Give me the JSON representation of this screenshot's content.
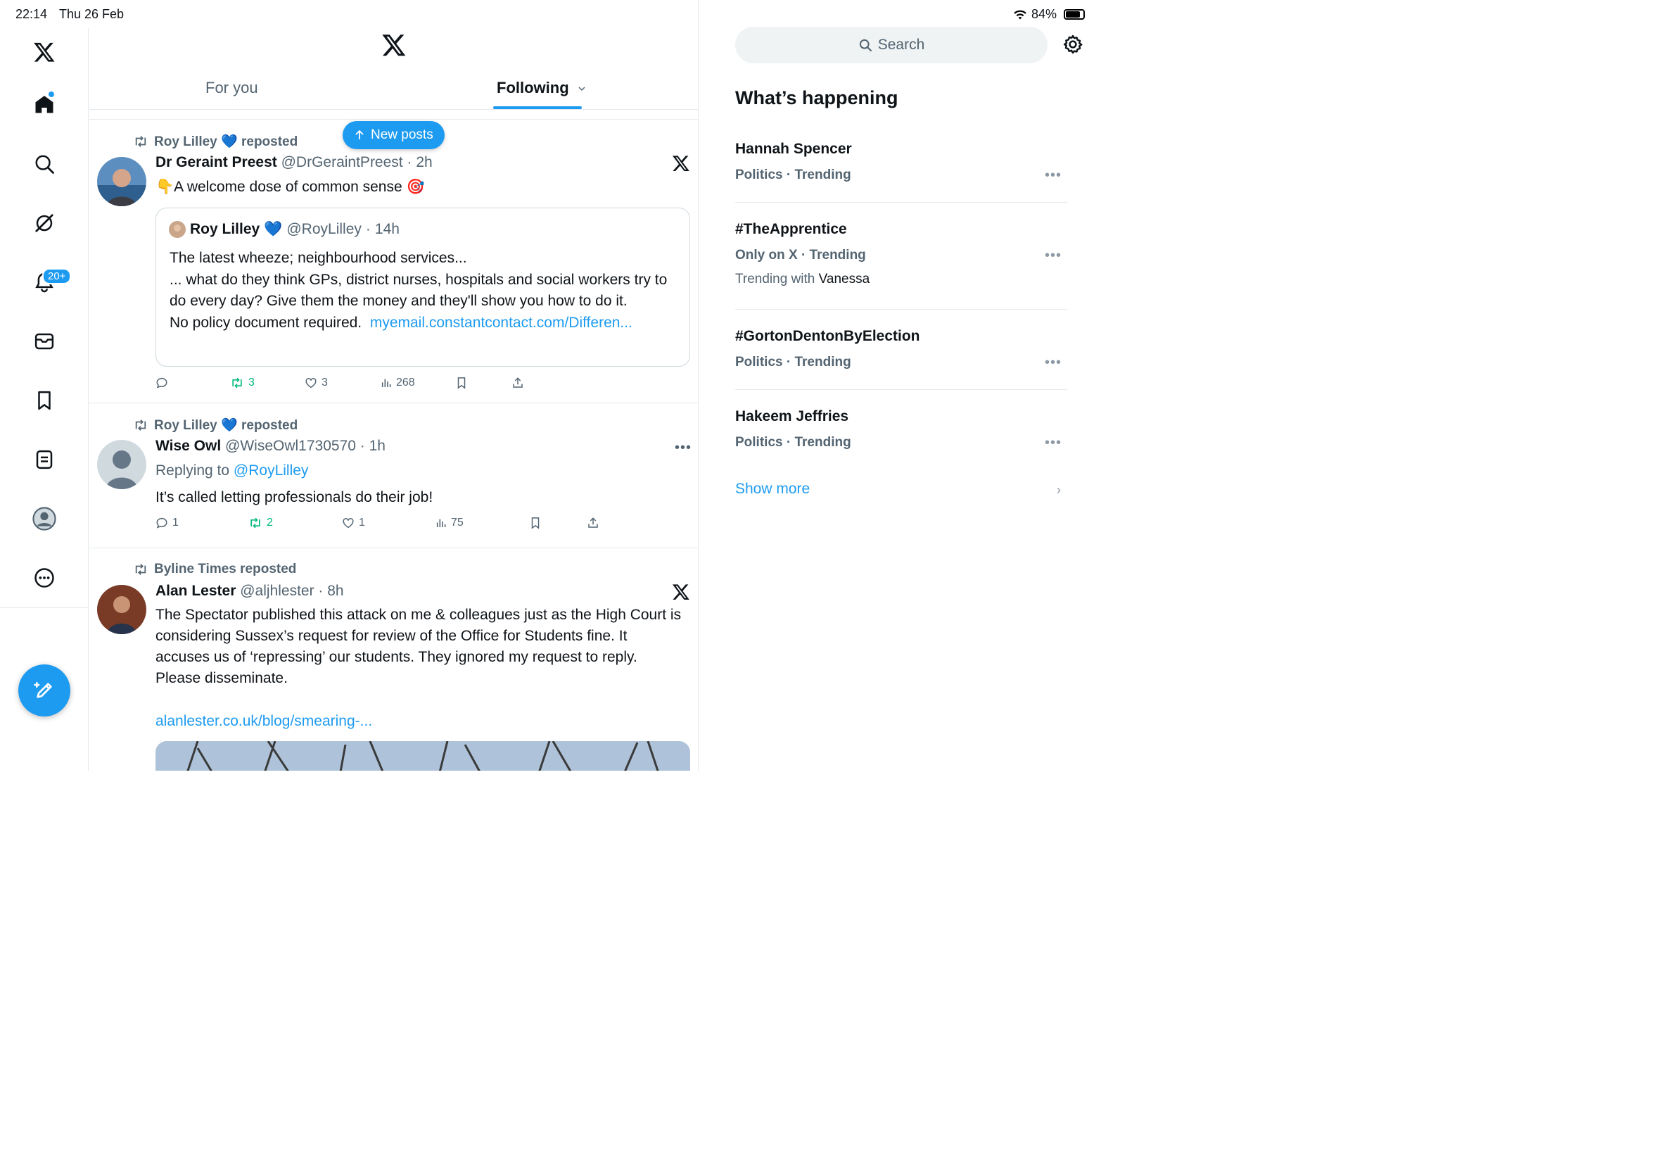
{
  "status_bar": {
    "time": "22:14",
    "date": "Thu 26 Feb",
    "battery": "84%"
  },
  "nav": {
    "notifications_badge": "20+"
  },
  "header": {
    "tabs": [
      {
        "label": "For you"
      },
      {
        "label": "Following"
      }
    ]
  },
  "new_posts": "New posts",
  "posts": [
    {
      "repost_by": "Roy Lilley",
      "repost_suffix": "reposted",
      "name": "Dr Geraint Preest",
      "handle": "@DrGeraintPreest",
      "time": "2h",
      "text": "A welcome dose of common sense",
      "quote": {
        "name": "Roy Lilley",
        "handle": "@RoyLilley",
        "time": "14h",
        "lines": [
          "The latest wheeze; neighbourhood services...",
          "... what do they think GPs, district nurses, hospitals and social workers try to do every day? Give them the money and they'll show you how to do it."
        ],
        "last_line": "No policy document required.",
        "link": "myemail.constantcontact.com/Differen..."
      },
      "stats": {
        "replies": "",
        "reposts": "3",
        "likes": "3",
        "views": "268"
      }
    },
    {
      "repost_by": "Roy Lilley",
      "repost_suffix": "reposted",
      "name": "Wise Owl",
      "handle": "@WiseOwl1730570",
      "time": "1h",
      "replying_prefix": "Replying to",
      "replying_to": "@RoyLilley",
      "text": "It’s called letting professionals do their job!",
      "stats": {
        "replies": "1",
        "reposts": "2",
        "likes": "1",
        "views": "75"
      }
    },
    {
      "repost_by": "Byline Times",
      "repost_suffix": "reposted",
      "name": "Alan Lester",
      "handle": "@aljhlester",
      "time": "8h",
      "text": "The Spectator published this attack on me & colleagues just as the High Court is considering Sussex’s request for review of the Office for Students fine. It accuses us of ‘repressing’ our students. They ignored my request to reply. Please disseminate.",
      "link": "alanlester.co.uk/blog/smearing-..."
    }
  ],
  "sidebar": {
    "search_placeholder": "Search",
    "heading": "What’s happening",
    "trends": [
      {
        "title": "Hannah Spencer",
        "meta": "Politics · Trending"
      },
      {
        "title": "#TheApprentice",
        "meta": "Only on X · Trending",
        "with_prefix": "Trending with",
        "with": "Vanessa"
      },
      {
        "title": "#GortonDentonByElection",
        "meta": "Politics · Trending"
      },
      {
        "title": "Hakeem Jeffries",
        "meta": "Politics · Trending"
      }
    ],
    "show_more": "Show more"
  },
  "colors": {
    "accent": "#1d9bf0",
    "repost_green": "#00ba7c",
    "muted": "#536471"
  }
}
